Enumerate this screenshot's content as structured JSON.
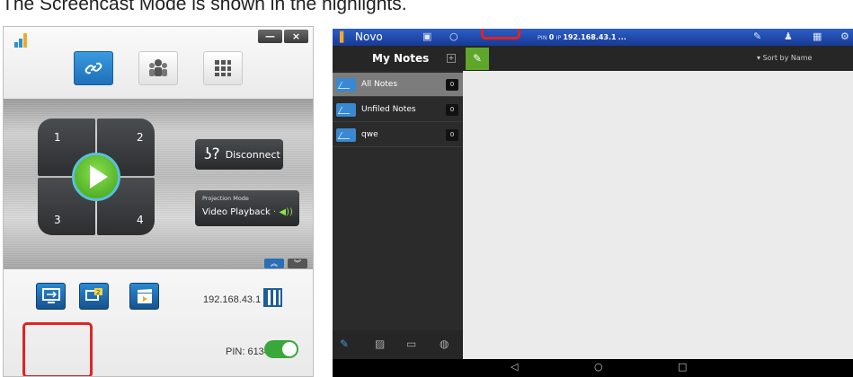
{
  "caption": "The Screencast Mode is shown in the highlights.",
  "left": {
    "window_buttons": [
      "—",
      "×"
    ],
    "quadrants": [
      "1",
      "2",
      "3",
      "4"
    ],
    "disconnect_label": "Disconnect",
    "projection_title": "Projection Mode",
    "projection_value": "Video Playback",
    "ip": "192.168.43.1",
    "pin": "PIN: 6134",
    "toggle_on": true,
    "icons": {
      "tab1": "link-icon",
      "tab2": "users-icon",
      "tab3": "grid-icon",
      "func1": "screen-share-icon",
      "func2": "split-screen-icon",
      "func3": "video-clapper-icon"
    },
    "colors": {
      "accent": "#1e6fb8",
      "toggle": "#38a83a",
      "highlight": "#e02424"
    }
  },
  "right": {
    "app_name": "Novo",
    "pin_label": "PIN",
    "pin_value": "0",
    "ip_label": "IP",
    "ip_value": "192.168.43.1",
    "more": "...",
    "title": "My Notes",
    "sort": "Sort by Name",
    "notes": [
      {
        "name": "All Notes",
        "count": "0"
      },
      {
        "name": "Unfiled Notes",
        "count": "0"
      },
      {
        "name": "qwe",
        "count": "0"
      }
    ],
    "colors": {
      "topbar": "#2d5ec6",
      "selected": "#7c7c7c",
      "edit": "#5fa72b"
    }
  }
}
